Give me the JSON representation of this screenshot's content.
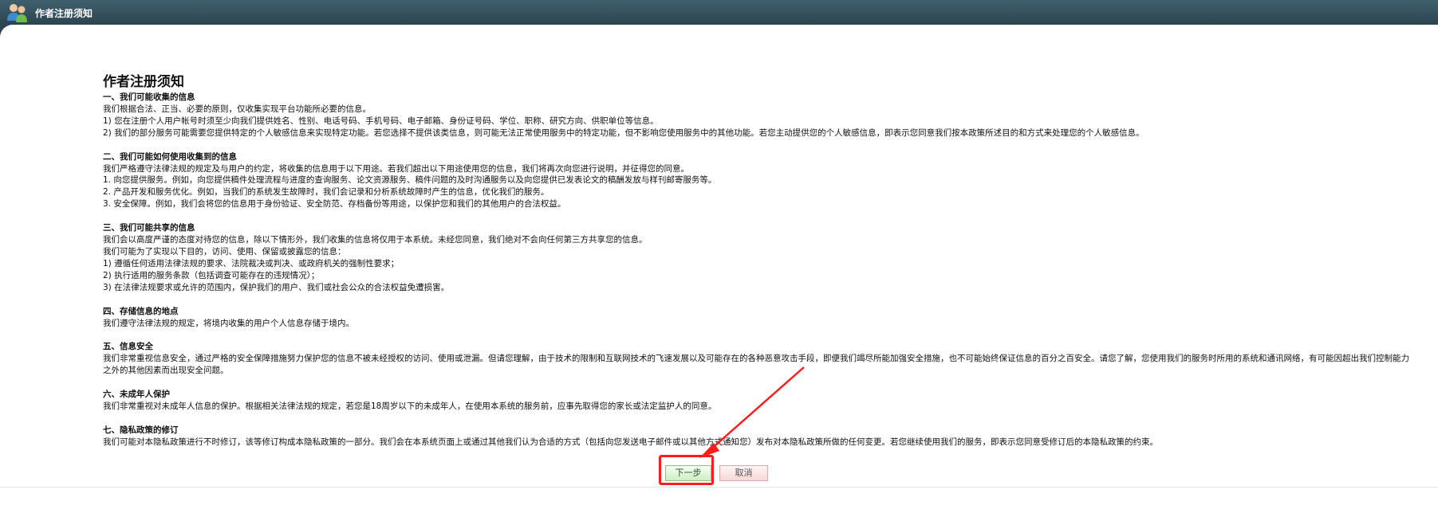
{
  "window": {
    "title": "作者注册须知",
    "icon": "users-icon"
  },
  "document": {
    "title": "作者注册须知",
    "sections": [
      {
        "heading": "一、我们可能收集的信息",
        "lines": [
          "我们根据合法、正当、必要的原则，仅收集实现平台功能所必要的信息。",
          "1) 您在注册个人用户帐号时须至少向我们提供姓名、性别、电话号码、手机号码、电子邮箱、身份证号码、学位、职称、研究方向、供职单位等信息。",
          "2) 我们的部分服务可能需要您提供特定的个人敏感信息来实现特定功能。若您选择不提供该类信息，则可能无法正常使用服务中的特定功能，但不影响您使用服务中的其他功能。若您主动提供您的个人敏感信息，即表示您同意我们按本政策所述目的和方式来处理您的个人敏感信息。"
        ]
      },
      {
        "heading": "二、我们可能如何使用收集到的信息",
        "lines": [
          "我们严格遵守法律法规的规定及与用户的约定，将收集的信息用于以下用途。若我们超出以下用途使用您的信息，我们将再次向您进行说明，并征得您的同意。",
          "1. 向您提供服务。例如，向您提供稿件处理流程与进度的查询服务、论文资源服务、稿件问题的及时沟通服务以及向您提供已发表论文的稿酬发放与样刊邮寄服务等。",
          "2. 产品开发和服务优化。例如，当我们的系统发生故障时，我们会记录和分析系统故障时产生的信息，优化我们的服务。",
          "3. 安全保障。例如，我们会将您的信息用于身份验证、安全防范、存档备份等用途，以保护您和我们的其他用户的合法权益。"
        ]
      },
      {
        "heading": "三、我们可能共享的信息",
        "lines": [
          "我们会以高度严谨的态度对待您的信息，除以下情形外，我们收集的信息将仅用于本系统。未经您同意，我们绝对不会向任何第三方共享您的信息。",
          "我们可能为了实现以下目的，访问、使用、保留或披露您的信息：",
          "1) 遵循任何适用法律法规的要求、法院裁决或判决、或政府机关的强制性要求；",
          "2) 执行适用的服务条款（包括调查可能存在的违规情况）；",
          "3) 在法律法规要求或允许的范围内，保护我们的用户、我们或社会公众的合法权益免遭损害。"
        ]
      },
      {
        "heading": "四、存储信息的地点",
        "lines": [
          "我们遵守法律法规的规定，将境内收集的用户个人信息存储于境内。"
        ]
      },
      {
        "heading": "五、信息安全",
        "lines": [
          "我们非常重视信息安全，通过严格的安全保障措施努力保护您的信息不被未经授权的访问、使用或泄漏。但请您理解，由于技术的限制和互联网技术的飞速发展以及可能存在的各种恶意攻击手段，即便我们竭尽所能加强安全措施，也不可能始终保证信息的百分之百安全。请您了解，您使用我们的服务时所用的系统和通讯网络，有可能因超出我们控制能力之外的其他因素而出现安全问题。"
        ]
      },
      {
        "heading": "六、未成年人保护",
        "lines": [
          "我们非常重视对未成年人信息的保护。根据相关法律法规的规定，若您是18周岁以下的未成年人，在使用本系统的服务前，应事先取得您的家长或法定监护人的同意。"
        ]
      },
      {
        "heading": "七、隐私政策的修订",
        "lines": [
          "我们可能对本隐私政策进行不时修订，该等修订构成本隐私政策的一部分。我们会在本系统页面上或通过其他我们认为合适的方式（包括向您发送电子邮件或以其他方式通知您）发布对本隐私政策所做的任何变更。若您继续使用我们的服务，即表示您同意受修订后的本隐私政策的约束。"
        ]
      }
    ]
  },
  "buttons": {
    "next_label": "下一步",
    "cancel_label": "取消"
  },
  "colors": {
    "titlebar": "#2c4551",
    "highlight": "#ff1c1c"
  }
}
